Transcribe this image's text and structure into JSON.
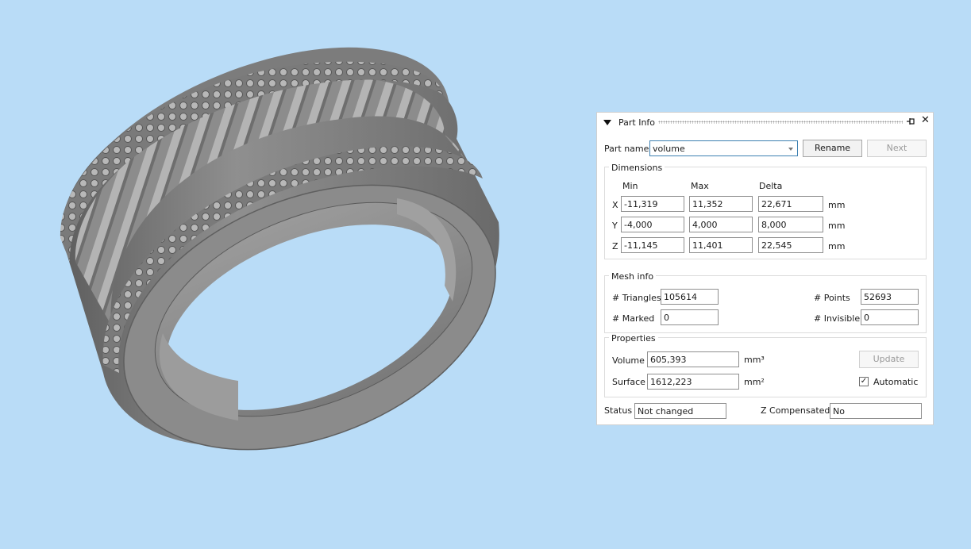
{
  "panel": {
    "title": "Part Info",
    "part_name_label": "Part name",
    "part_name_value": "volume",
    "rename_label": "Rename",
    "next_label": "Next",
    "dimensions": {
      "title": "Dimensions",
      "headers": [
        "Min",
        "Max",
        "Delta"
      ],
      "rows": [
        {
          "axis": "X",
          "min": "-11,319",
          "max": "11,352",
          "delta": "22,671",
          "unit": "mm"
        },
        {
          "axis": "Y",
          "min": "-4,000",
          "max": "4,000",
          "delta": "8,000",
          "unit": "mm"
        },
        {
          "axis": "Z",
          "min": "-11,145",
          "max": "11,401",
          "delta": "22,545",
          "unit": "mm"
        }
      ]
    },
    "mesh": {
      "title": "Mesh info",
      "triangles_label": "# Triangles",
      "triangles": "105614",
      "points_label": "# Points",
      "points": "52693",
      "marked_label": "# Marked",
      "marked": "0",
      "invisible_label": "# Invisible",
      "invisible": "0"
    },
    "properties": {
      "title": "Properties",
      "volume_label": "Volume",
      "volume": "605,393",
      "volume_unit": "mm³",
      "surface_label": "Surface",
      "surface": "1612,223",
      "surface_unit": "mm²",
      "update_label": "Update",
      "automatic_label": "Automatic",
      "automatic_checked": true
    },
    "status_label": "Status",
    "status": "Not changed",
    "zcomp_label": "Z Compensated",
    "zcomp": "No"
  },
  "icons": {
    "collapse": "triangle-down-icon",
    "pin": "pin-icon",
    "close": "close-icon",
    "check": "✓",
    "close_glyph": "✕"
  },
  "colors": {
    "background": "#b9dcf7",
    "model": "#8a8a8a",
    "panel": "#ffffff"
  }
}
